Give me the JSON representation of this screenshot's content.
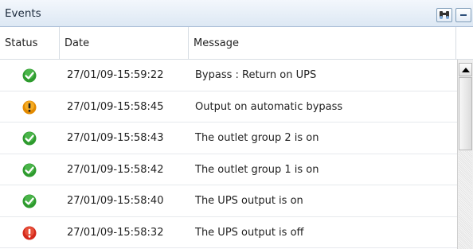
{
  "panel": {
    "title": "Events"
  },
  "columns": {
    "status": "Status",
    "date": "Date",
    "message": "Message"
  },
  "status_colors": {
    "ok": "#2e9b2e",
    "warning": "#e38a00",
    "error": "#d42a1d"
  },
  "events": [
    {
      "status": "ok",
      "status_icon": "check-icon",
      "date": "27/01/09-15:59:22",
      "message": "Bypass : Return on UPS"
    },
    {
      "status": "warning",
      "status_icon": "warning-icon",
      "date": "27/01/09-15:58:45",
      "message": "Output on automatic bypass"
    },
    {
      "status": "ok",
      "status_icon": "check-icon",
      "date": "27/01/09-15:58:43",
      "message": "The outlet group 2 is on"
    },
    {
      "status": "ok",
      "status_icon": "check-icon",
      "date": "27/01/09-15:58:42",
      "message": "The outlet group 1 is on"
    },
    {
      "status": "ok",
      "status_icon": "check-icon",
      "date": "27/01/09-15:58:40",
      "message": "The UPS output is on"
    },
    {
      "status": "error",
      "status_icon": "error-icon",
      "date": "27/01/09-15:58:32",
      "message": "The UPS output is off"
    }
  ]
}
